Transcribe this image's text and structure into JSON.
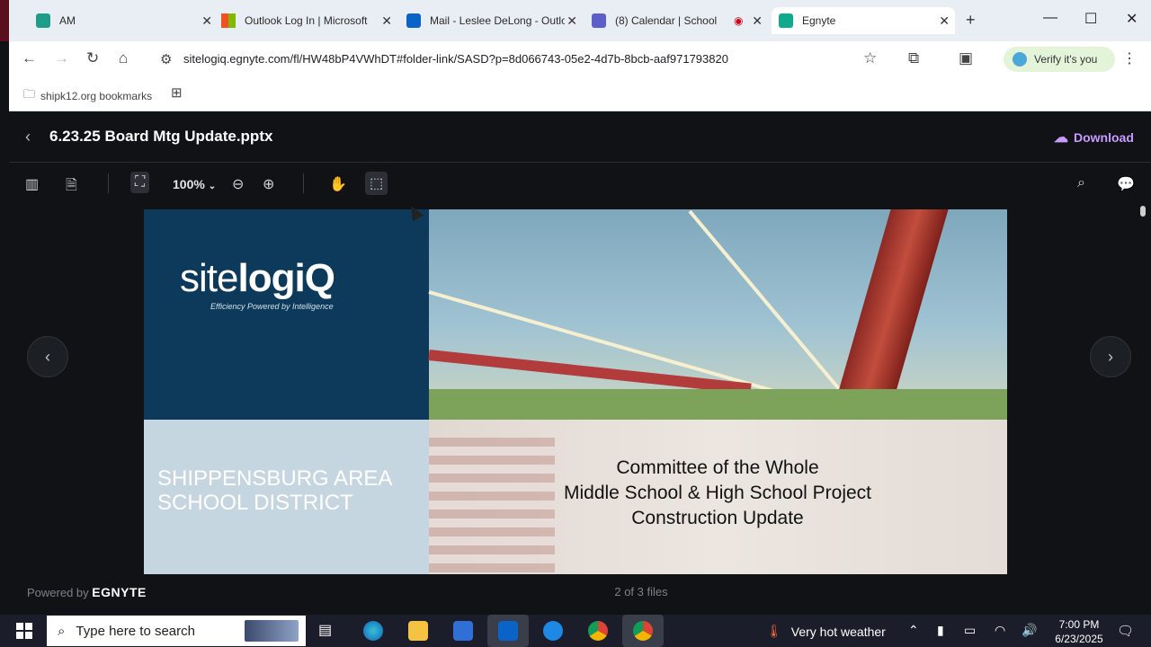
{
  "browser": {
    "tabs": [
      {
        "title": "AM",
        "icon": "app-icon",
        "color": "#1f9d8a"
      },
      {
        "title": "Outlook Log In | Microsoft",
        "icon": "microsoft-icon",
        "color": "#f25022"
      },
      {
        "title": "Mail - Leslee DeLong - Outlook",
        "icon": "outlook-icon",
        "color": "#0a64c8"
      },
      {
        "title": "(8) Calendar | School",
        "icon": "teams-icon",
        "color": "#5b5fc7"
      },
      {
        "title": "Egnyte",
        "icon": "egnyte-icon",
        "color": "#11a98b"
      }
    ],
    "new_tab_symbol": "+",
    "url": "sitelogiq.egnyte.com/fl/HW48bP4VWhDT#folder-link/SASD?p=8d066743-05e2-4d7b-8bcb-aaf971793820",
    "verify_label": "Verify it's you",
    "bookmark_label": "shipk12.org bookmarks"
  },
  "viewer": {
    "filename": "6.23.25 Board Mtg Update.pptx",
    "download_label": "Download",
    "zoom_level": "100%",
    "file_count": "2 of 3 files",
    "powered_by": "Powered by",
    "powered_brand": "EGNYTE",
    "accent_color": "#c79cff"
  },
  "slide": {
    "logo_regular": "site",
    "logo_bold": "logiQ",
    "tagline": "Efficiency Powered by Intelligence",
    "district": "SHIPPENSBURG  AREA SCHOOL DISTRICT",
    "caption_line1": "Committee of the Whole",
    "caption_line2": "Middle School & High School Project",
    "caption_line3": "Construction Update"
  },
  "taskbar": {
    "search_placeholder": "Type here to search",
    "weather": "Very hot weather",
    "time": "7:00 PM",
    "date": "6/23/2025"
  }
}
